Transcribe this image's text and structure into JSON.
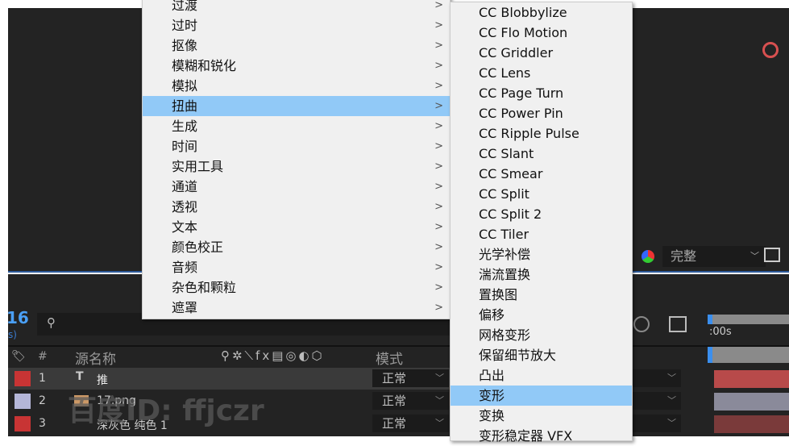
{
  "effects_menu": {
    "items": [
      {
        "label": "过渡"
      },
      {
        "label": "过时"
      },
      {
        "label": "抠像"
      },
      {
        "label": "模糊和锐化"
      },
      {
        "label": "模拟"
      },
      {
        "label": "扭曲",
        "highlighted": true
      },
      {
        "label": "生成"
      },
      {
        "label": "时间"
      },
      {
        "label": "实用工具"
      },
      {
        "label": "通道"
      },
      {
        "label": "透视"
      },
      {
        "label": "文本"
      },
      {
        "label": "颜色校正"
      },
      {
        "label": "音频"
      },
      {
        "label": "杂色和颗粒"
      },
      {
        "label": "遮罩"
      }
    ],
    "arrow": ">"
  },
  "distort_submenu": {
    "items": [
      {
        "label": "CC Blobbylize"
      },
      {
        "label": "CC Flo Motion"
      },
      {
        "label": "CC Griddler"
      },
      {
        "label": "CC Lens"
      },
      {
        "label": "CC Page Turn"
      },
      {
        "label": "CC Power Pin"
      },
      {
        "label": "CC Ripple Pulse"
      },
      {
        "label": "CC Slant"
      },
      {
        "label": "CC Smear"
      },
      {
        "label": "CC Split"
      },
      {
        "label": "CC Split 2"
      },
      {
        "label": "CC Tiler"
      },
      {
        "label": "光学补偿"
      },
      {
        "label": "湍流置换"
      },
      {
        "label": "置换图"
      },
      {
        "label": "偏移"
      },
      {
        "label": "网格变形"
      },
      {
        "label": "保留细节放大"
      },
      {
        "label": "凸出"
      },
      {
        "label": "变形",
        "highlighted": true
      },
      {
        "label": "变换"
      },
      {
        "label": "变形稳定器 VFX"
      }
    ]
  },
  "viewer": {
    "resolution": "完整"
  },
  "timeline": {
    "timecode": "16",
    "fps": "s)",
    "time_ruler": ":00s",
    "headers": {
      "num": "#",
      "source": "源名称",
      "mode": "模式"
    },
    "layers": [
      {
        "num": "1",
        "name": "推",
        "color": "#c83434",
        "mode": "正常"
      },
      {
        "num": "2",
        "name": "17.png",
        "color": "#b4b6d8",
        "mode": "正常"
      },
      {
        "num": "3",
        "name": "深灰色 纯色 1",
        "color": "#c83434",
        "mode": "正常"
      }
    ]
  },
  "watermark": "百度ID: ffjczr",
  "colors": {
    "highlight": "#91c9f7",
    "panel": "#232323"
  }
}
